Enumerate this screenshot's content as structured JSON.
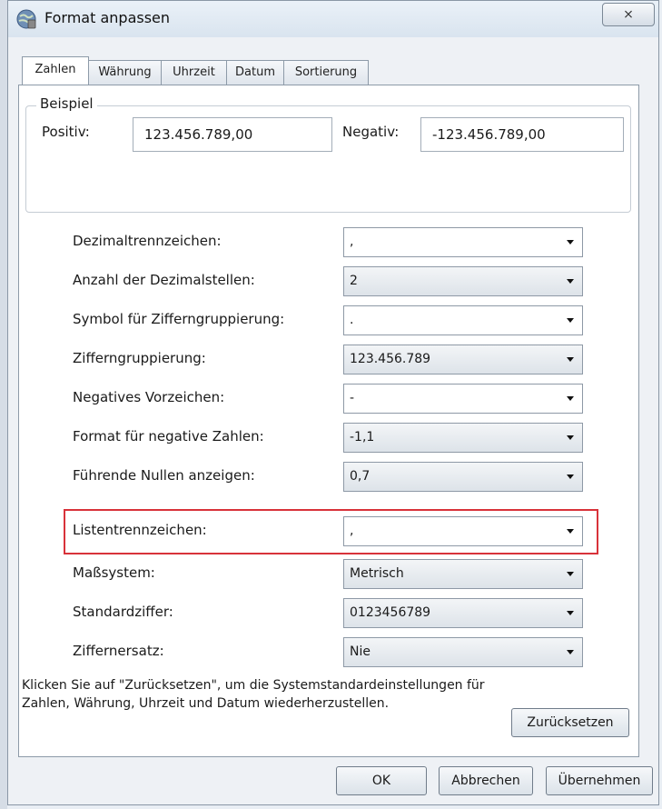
{
  "window": {
    "title": "Format anpassen",
    "close_label": "⨯"
  },
  "tabs": [
    {
      "label": "Zahlen"
    },
    {
      "label": "Währung"
    },
    {
      "label": "Uhrzeit"
    },
    {
      "label": "Datum"
    },
    {
      "label": "Sortierung"
    }
  ],
  "example": {
    "legend": "Beispiel",
    "positive_label": "Positiv:",
    "positive_value": "123.456.789,00",
    "negative_label": "Negativ:",
    "negative_value": "-123.456.789,00"
  },
  "settings": [
    {
      "label": "Dezimaltrennzeichen:",
      "value": ","
    },
    {
      "label": "Anzahl der Dezimalstellen:",
      "value": "2"
    },
    {
      "label": "Symbol für Zifferngruppierung:",
      "value": "."
    },
    {
      "label": "Zifferngruppierung:",
      "value": "123.456.789"
    },
    {
      "label": "Negatives Vorzeichen:",
      "value": "-"
    },
    {
      "label": "Format für negative Zahlen:",
      "value": "-1,1"
    },
    {
      "label": "Führende Nullen anzeigen:",
      "value": "0,7"
    },
    {
      "label": "Listentrennzeichen:",
      "value": ","
    },
    {
      "label": "Maßsystem:",
      "value": "Metrisch"
    },
    {
      "label": "Standardziffer:",
      "value": "0123456789"
    },
    {
      "label": "Ziffernersatz:",
      "value": "Nie"
    }
  ],
  "info_text": "Klicken Sie auf \"Zurücksetzen\", um die Systemstandardeinstellungen für Zahlen, Währung, Uhrzeit und Datum wiederherzustellen.",
  "buttons": {
    "reset": "Zurücksetzen",
    "ok": "OK",
    "cancel": "Abbrechen",
    "apply": "Übernehmen"
  },
  "colors": {
    "highlight": "#d8323a",
    "window_border": "#8a97a6"
  }
}
